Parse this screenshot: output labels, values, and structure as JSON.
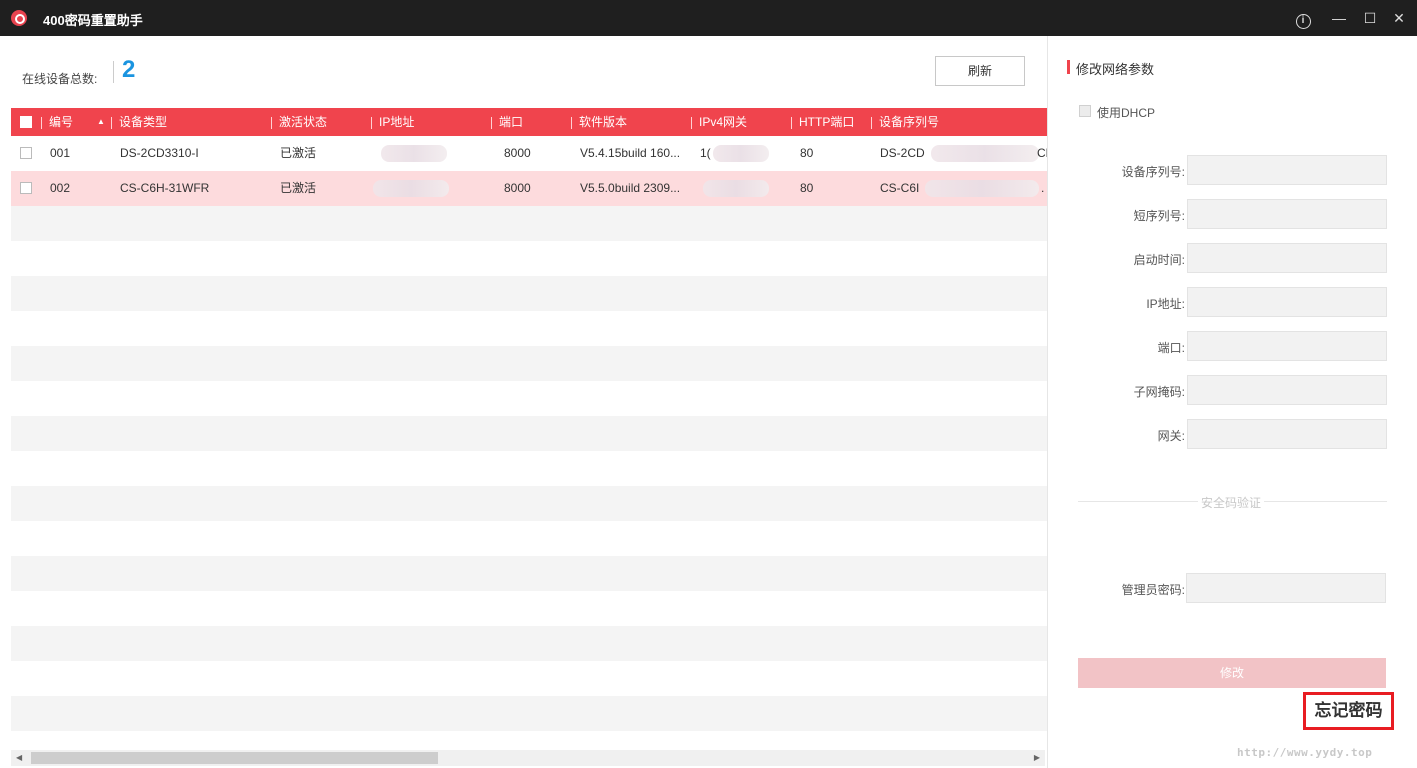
{
  "window": {
    "title": "400密码重置助手",
    "info_icon": "info-icon",
    "minimize_icon": "minimize-icon",
    "maximize_icon": "maximize-icon",
    "close_icon": "close-icon"
  },
  "device_list": {
    "online_label": "在线设备总数:",
    "online_count": "2",
    "refresh_label": "刷新",
    "columns": [
      "编号",
      "设备类型",
      "激活状态",
      "IP地址",
      "端口",
      "软件版本",
      "IPv4网关",
      "HTTP端口",
      "设备序列号"
    ],
    "rows": [
      {
        "id": "001",
        "type": "DS-2CD3310-I",
        "status": "已激活",
        "ip": "",
        "port": "8000",
        "version": "V5.4.15build 160...",
        "gateway": "1(",
        "http_port": "80",
        "serial": "DS-2CD",
        "serial_tail": "CH"
      },
      {
        "id": "002",
        "type": "CS-C6H-31WFR",
        "status": "已激活",
        "ip": "",
        "port": "8000",
        "version": "V5.5.0build 2309...",
        "gateway": "",
        "http_port": "80",
        "serial": "CS-C6I",
        "serial_tail": "."
      }
    ]
  },
  "network_panel": {
    "title": "修改网络参数",
    "dhcp_label": "使用DHCP",
    "fields": [
      {
        "label": "设备序列号:",
        "value": ""
      },
      {
        "label": "短序列号:",
        "value": ""
      },
      {
        "label": "启动时间:",
        "value": ""
      },
      {
        "label": "IP地址:",
        "value": ""
      },
      {
        "label": "端口:",
        "value": ""
      },
      {
        "label": "子网掩码:",
        "value": ""
      },
      {
        "label": "网关:",
        "value": ""
      }
    ],
    "security_label": "安全码验证",
    "admin_password_label": "管理员密码:",
    "modify_label": "修改",
    "forgot_password_label": "忘记密码"
  },
  "watermark": "http://www.yydy.top",
  "colors": {
    "accent": "#f0444d",
    "count_blue": "#1a94e0",
    "selected_row": "#fddbdd",
    "annotation_red": "#e81c22"
  }
}
